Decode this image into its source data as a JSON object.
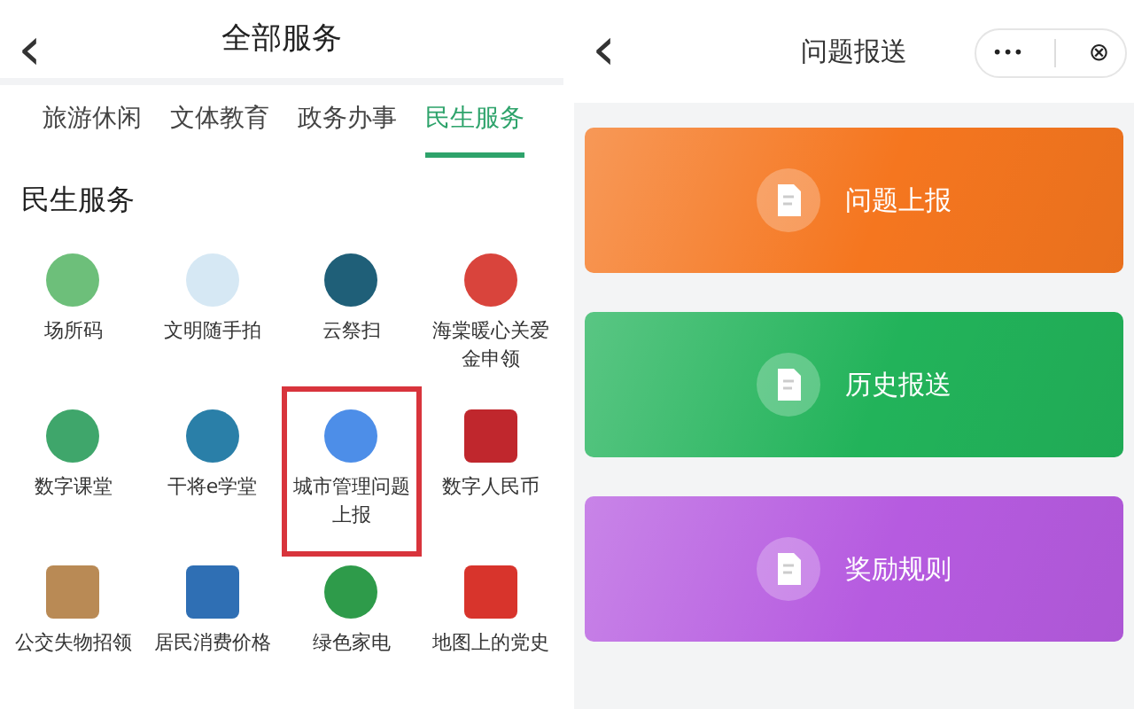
{
  "left": {
    "back": "‹",
    "title": "全部服务",
    "tabs": [
      {
        "label": "旅游休闲",
        "selected": false
      },
      {
        "label": "文体教育",
        "selected": false
      },
      {
        "label": "政务办事",
        "selected": false
      },
      {
        "label": "民生服务",
        "selected": true
      }
    ],
    "section_title": "民生服务",
    "services": [
      {
        "label": "场所码",
        "kind": "circle",
        "color": "#6dbf7a",
        "highlighted": false
      },
      {
        "label": "文明随手拍",
        "kind": "circle",
        "color": "#d6e8f4",
        "highlighted": false
      },
      {
        "label": "云祭扫",
        "kind": "circle",
        "color": "#1f5f78",
        "highlighted": false
      },
      {
        "label": "海棠暖心关爱金申领",
        "kind": "circle",
        "color": "#d9443c",
        "highlighted": false
      },
      {
        "label": "数字课堂",
        "kind": "circle",
        "color": "#3fa66b",
        "highlighted": false
      },
      {
        "label": "干将e学堂",
        "kind": "circle",
        "color": "#2a7fa8",
        "highlighted": false
      },
      {
        "label": "城市管理问题上报",
        "kind": "circle",
        "color": "#4d8ee8",
        "highlighted": true
      },
      {
        "label": "数字人民币",
        "kind": "square",
        "color": "#c0272d",
        "highlighted": false
      },
      {
        "label": "公交失物招领",
        "kind": "square",
        "color": "#b98a55",
        "highlighted": false
      },
      {
        "label": "居民消费价格",
        "kind": "square",
        "color": "#2f6fb4",
        "highlighted": false
      },
      {
        "label": "绿色家电",
        "kind": "circle",
        "color": "#2e9b4a",
        "highlighted": false
      },
      {
        "label": "地图上的党史",
        "kind": "square",
        "color": "#d8342c",
        "highlighted": false
      }
    ]
  },
  "right": {
    "back": "‹",
    "title": "问题报送",
    "more": "•••",
    "close": "⊗",
    "cards": [
      {
        "label": "问题上报",
        "color": "#f5761f"
      },
      {
        "label": "历史报送",
        "color": "#22b35a"
      },
      {
        "label": "奖励规则",
        "color": "#b65be0"
      }
    ]
  }
}
